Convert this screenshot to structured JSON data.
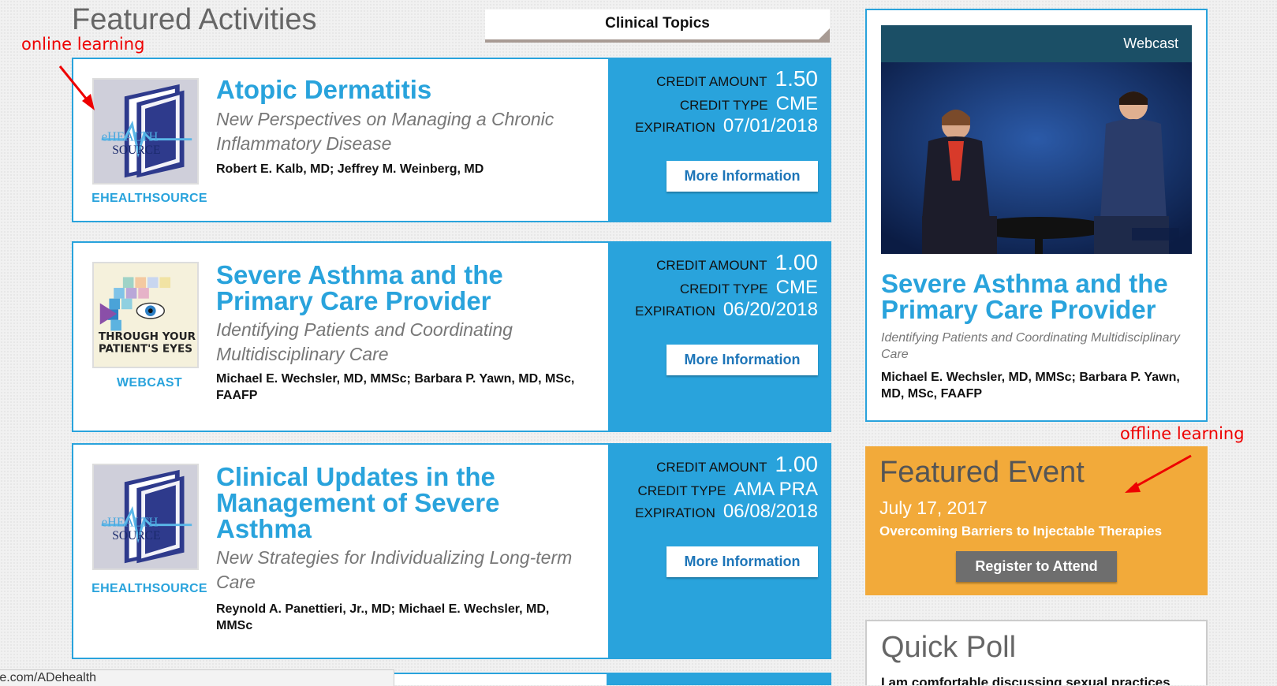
{
  "page": {
    "featured_heading": "Featured Activities",
    "topics_tab": "Clinical Topics"
  },
  "annotations": {
    "online": "online learning",
    "offline": "offline learning"
  },
  "labels": {
    "credit_amount": "CREDIT AMOUNT",
    "credit_type": "CREDIT TYPE",
    "expiration": "EXPIRATION",
    "more_info": "More Information"
  },
  "activities": [
    {
      "title": "Atopic Dermatitis",
      "subtitle": "New Perspectives on Managing a Chronic Inflammatory Disease",
      "authors": "Robert E. Kalb, MD; Jeffrey M. Weinberg, MD",
      "provider": "EHEALTHSOURCE",
      "thumb": "ehealthsource-book-logo",
      "credit_amount": "1.50",
      "credit_type": "CME",
      "expiration": "07/01/2018"
    },
    {
      "title": "Severe Asthma and the Primary Care Provider",
      "subtitle": "Identifying Patients and Coordinating Multidisciplinary Care",
      "authors": "Michael E. Wechsler, MD, MMSc; Barbara P. Yawn, MD, MSc, FAAFP",
      "provider": "WEBCAST",
      "thumb": "through-your-patients-eyes-logo",
      "thumb_text_1": "THROUGH YOUR",
      "thumb_text_2": "PATIENT'S EYES",
      "credit_amount": "1.00",
      "credit_type": "CME",
      "expiration": "06/20/2018"
    },
    {
      "title": "Clinical Updates in the Management of Severe Asthma",
      "subtitle": "New Strategies for Individualizing Long-term Care",
      "authors": "Reynold A. Panettieri, Jr., MD; Michael E. Wechsler, MD, MMSc",
      "provider": "EHEALTHSOURCE",
      "thumb": "ehealthsource-book-logo",
      "credit_amount": "1.00",
      "credit_type": "AMA PRA",
      "expiration": "06/08/2018"
    }
  ],
  "webcast": {
    "label": "Webcast",
    "title": "Severe Asthma and the Primary Care Provider",
    "subtitle": "Identifying Patients and Coordinating Multidisciplinary Care",
    "authors": "Michael E. Wechsler, MD, MMSc; Barbara P. Yawn, MD, MSc, FAAFP"
  },
  "event": {
    "heading": "Featured Event",
    "date": "July 17, 2017",
    "name": "Overcoming Barriers to Injectable Therapies",
    "button": "Register to Attend"
  },
  "poll": {
    "heading": "Quick Poll",
    "question": "I am comfortable discussing sexual practices"
  },
  "status_bar": {
    "url": "me.com/ADehealth"
  },
  "colors": {
    "accent_blue": "#29a3dc",
    "event_orange": "#f2aa3a",
    "button_link_blue": "#1d75b8",
    "annotation_red": "#ee0000",
    "webcast_bar": "#1b4f66"
  },
  "logo_text": {
    "ehealth_1": "eHEALTH",
    "ehealth_2": "SOURCE"
  }
}
